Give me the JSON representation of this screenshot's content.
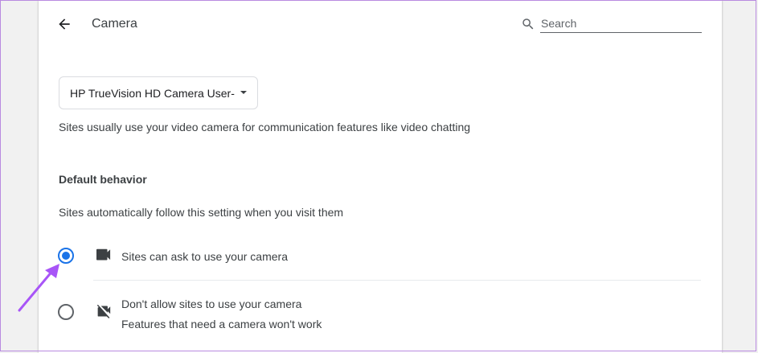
{
  "header": {
    "title": "Camera",
    "back_icon": "arrow-left-icon",
    "search": {
      "placeholder": "Search",
      "value": "",
      "icon": "search-icon"
    }
  },
  "device_select": {
    "selected": "HP TrueVision HD Camera User-"
  },
  "description": "Sites usually use your video camera for communication features like video chatting",
  "default_behavior": {
    "title": "Default behavior",
    "description": "Sites automatically follow this setting when you visit them",
    "options": [
      {
        "label": "Sites can ask to use your camera",
        "checked": true,
        "icon": "videocam-icon"
      },
      {
        "label": "Don't allow sites to use your camera",
        "sublabel": "Features that need a camera won't work",
        "checked": false,
        "icon": "videocam-off-icon"
      }
    ]
  },
  "annotation": {
    "icon": "pointer-arrow-annotation",
    "color": "#a855f7"
  },
  "colors": {
    "accent": "#1a73e8",
    "annotation": "#a855f7",
    "frame": "#b98ae0"
  }
}
